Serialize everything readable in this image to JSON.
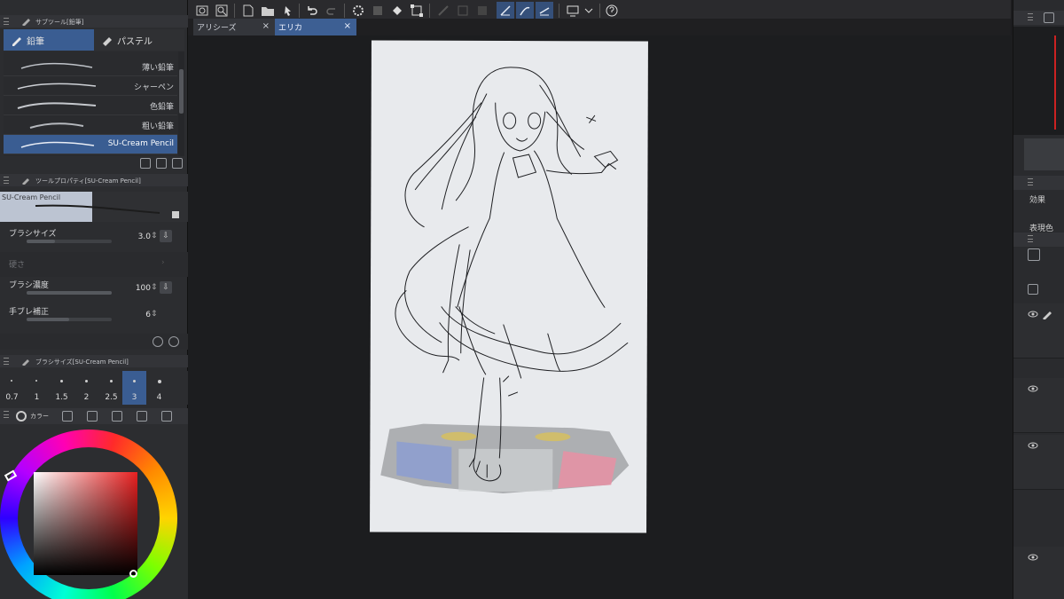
{
  "document_tabs": [
    {
      "label": "アリシーズ",
      "close": "×"
    },
    {
      "label": "エリカ",
      "close": "×"
    }
  ],
  "sub_tool_panel": {
    "title": "サブツール[鉛筆]",
    "tabs": [
      {
        "label": "鉛筆",
        "icon": "pencil-icon",
        "selected": true
      },
      {
        "label": "パステル",
        "icon": "pastel-icon",
        "selected": false
      }
    ],
    "brushes": [
      {
        "name": "薄い鉛筆",
        "selected": false
      },
      {
        "name": "シャーペン",
        "selected": false
      },
      {
        "name": "色鉛筆",
        "selected": false
      },
      {
        "name": "粗い鉛筆",
        "selected": false
      },
      {
        "name": "SU-Cream Pencil",
        "selected": true
      }
    ]
  },
  "tool_property_panel": {
    "title": "ツールプロパティ[SU-Cream Pencil]",
    "preview_label": "SU-Cream Pencil",
    "rows": [
      {
        "label": "ブラシサイズ",
        "value": "3.0",
        "level": 0.33
      },
      {
        "label": "硬さ",
        "value": "",
        "disabled": true
      },
      {
        "label": "ブラシ濃度",
        "value": "100",
        "level": 1.0
      },
      {
        "label": "手ブレ補正",
        "value": "6",
        "level": 0.06
      }
    ]
  },
  "brush_size_panel": {
    "title": "ブラシサイズ[SU-Cream Pencil]",
    "sizes": [
      "0.7",
      "1",
      "1.5",
      "2",
      "2.5",
      "3",
      "4"
    ],
    "selected": "3"
  },
  "color_panel": {
    "title": "カラー",
    "hue_color": "#e82020"
  },
  "right_panel": {
    "effect_label": "効果",
    "partial_label": "表現色"
  },
  "colors": {
    "accent": "#3a5d92",
    "panel": "#2c2d30",
    "canvas_bg": "#1c1d1f",
    "paper": "#e8eaed"
  }
}
